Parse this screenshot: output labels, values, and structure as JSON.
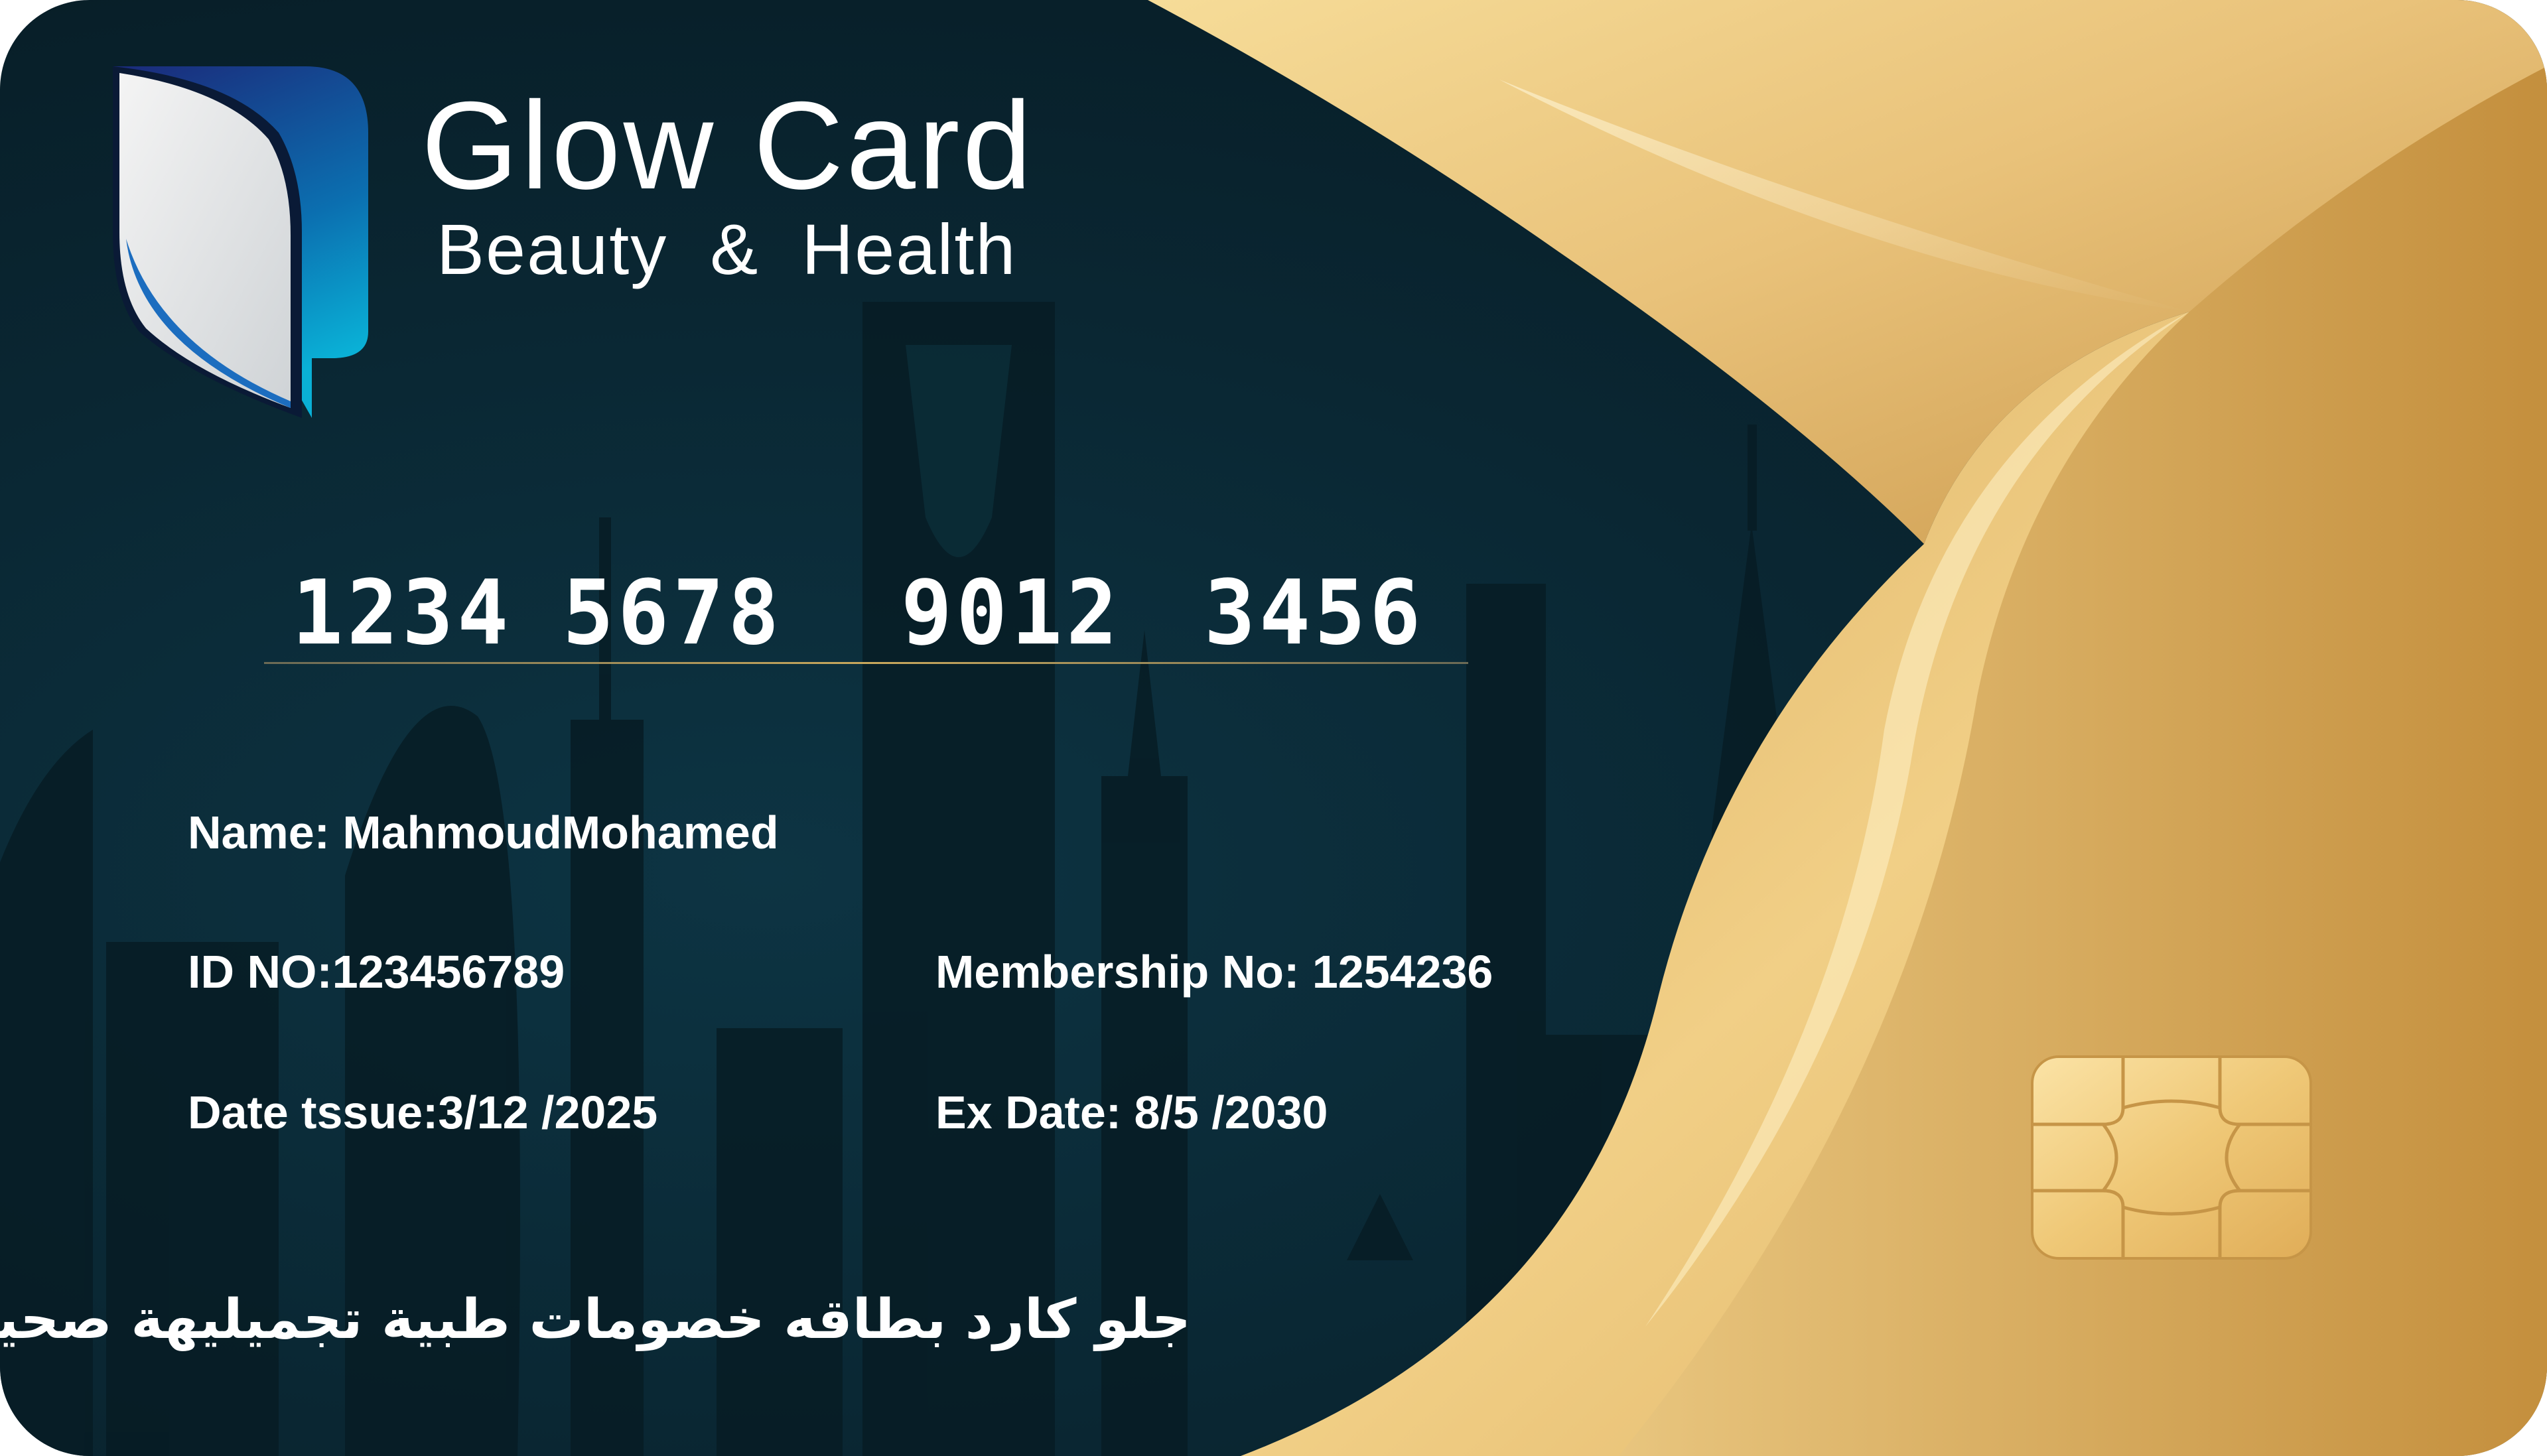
{
  "brand": {
    "title": "Glow Card",
    "subtitle": "Beauty  &  Health"
  },
  "card_number": {
    "groups": [
      "1234",
      "5678",
      "9012",
      "3456"
    ]
  },
  "fields": {
    "name": "Name: MahmoudMohamed",
    "id_no": "ID NO:123456789",
    "membership_no": "Membership No: 1254236",
    "date_issue": "Date tssue:3/12 /2025",
    "ex_date": "Ex Date: 8/5 /2030"
  },
  "arabic_tagline": "جلو كارد بطاقه خصومات طبية تجميليهة صحية",
  "colors": {
    "card_dark": "#0a2733",
    "gold_light": "#f3d48a",
    "gold_dark": "#c08f3c",
    "logo_blue": "#0aa3c9",
    "logo_navy": "#1b2a7a"
  },
  "icons": [
    "leaf-logo-icon",
    "chip-icon",
    "city-skyline"
  ]
}
